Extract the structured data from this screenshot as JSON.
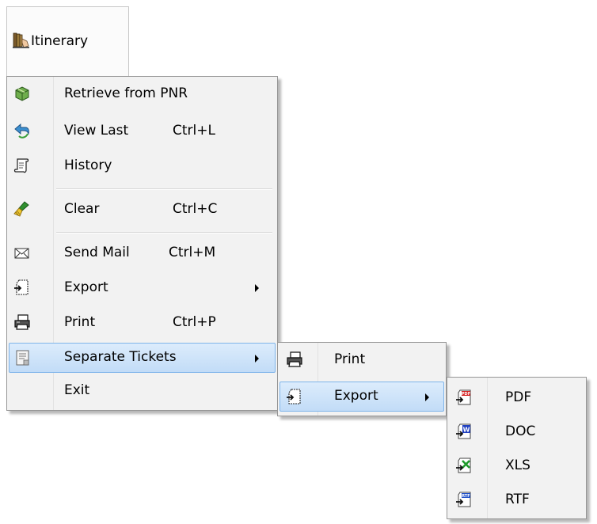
{
  "menubar": {
    "title": "Itinerary",
    "icon": "itinerary-books-icon"
  },
  "main_menu": {
    "items": [
      {
        "label": "Retrieve from PNR",
        "shortcut": "",
        "icon": "retrieve-box-icon"
      },
      {
        "label": "View Last",
        "shortcut": "Ctrl+L",
        "icon": "back-arrow-icon"
      },
      {
        "label": "History",
        "shortcut": "",
        "icon": "scroll-icon"
      },
      {
        "label": "Clear",
        "shortcut": "Ctrl+C",
        "icon": "broom-icon"
      },
      {
        "label": "Send Mail",
        "shortcut": "Ctrl+M",
        "icon": "envelope-icon"
      },
      {
        "label": "Export",
        "shortcut": "",
        "icon": "export-icon",
        "submenu": true
      },
      {
        "label": "Print",
        "shortcut": "Ctrl+P",
        "icon": "printer-icon"
      },
      {
        "label": "Separate Tickets",
        "shortcut": "",
        "icon": "ticket-doc-icon",
        "submenu": true,
        "highlighted": true
      },
      {
        "label": "Exit",
        "shortcut": "",
        "icon": ""
      }
    ]
  },
  "separate_tickets_menu": {
    "items": [
      {
        "label": "Print",
        "icon": "printer-icon"
      },
      {
        "label": "Export",
        "icon": "export-icon",
        "submenu": true,
        "highlighted": true
      }
    ]
  },
  "export_menu": {
    "items": [
      {
        "label": "PDF",
        "icon": "pdf-export-icon",
        "badge": "PDF",
        "color": "#d42020"
      },
      {
        "label": "DOC",
        "icon": "doc-export-icon",
        "badge": "W",
        "color": "#2040c0"
      },
      {
        "label": "XLS",
        "icon": "xls-export-icon",
        "badge": "X",
        "color": "#1f9a2c"
      },
      {
        "label": "RTF",
        "icon": "rtf-export-icon",
        "badge": "RTF",
        "color": "#2050c8"
      }
    ]
  },
  "colors": {
    "menu_bg": "#f2f2f2",
    "highlight_border": "#7eb4ea",
    "highlight_fill": "#c9e0f8"
  }
}
